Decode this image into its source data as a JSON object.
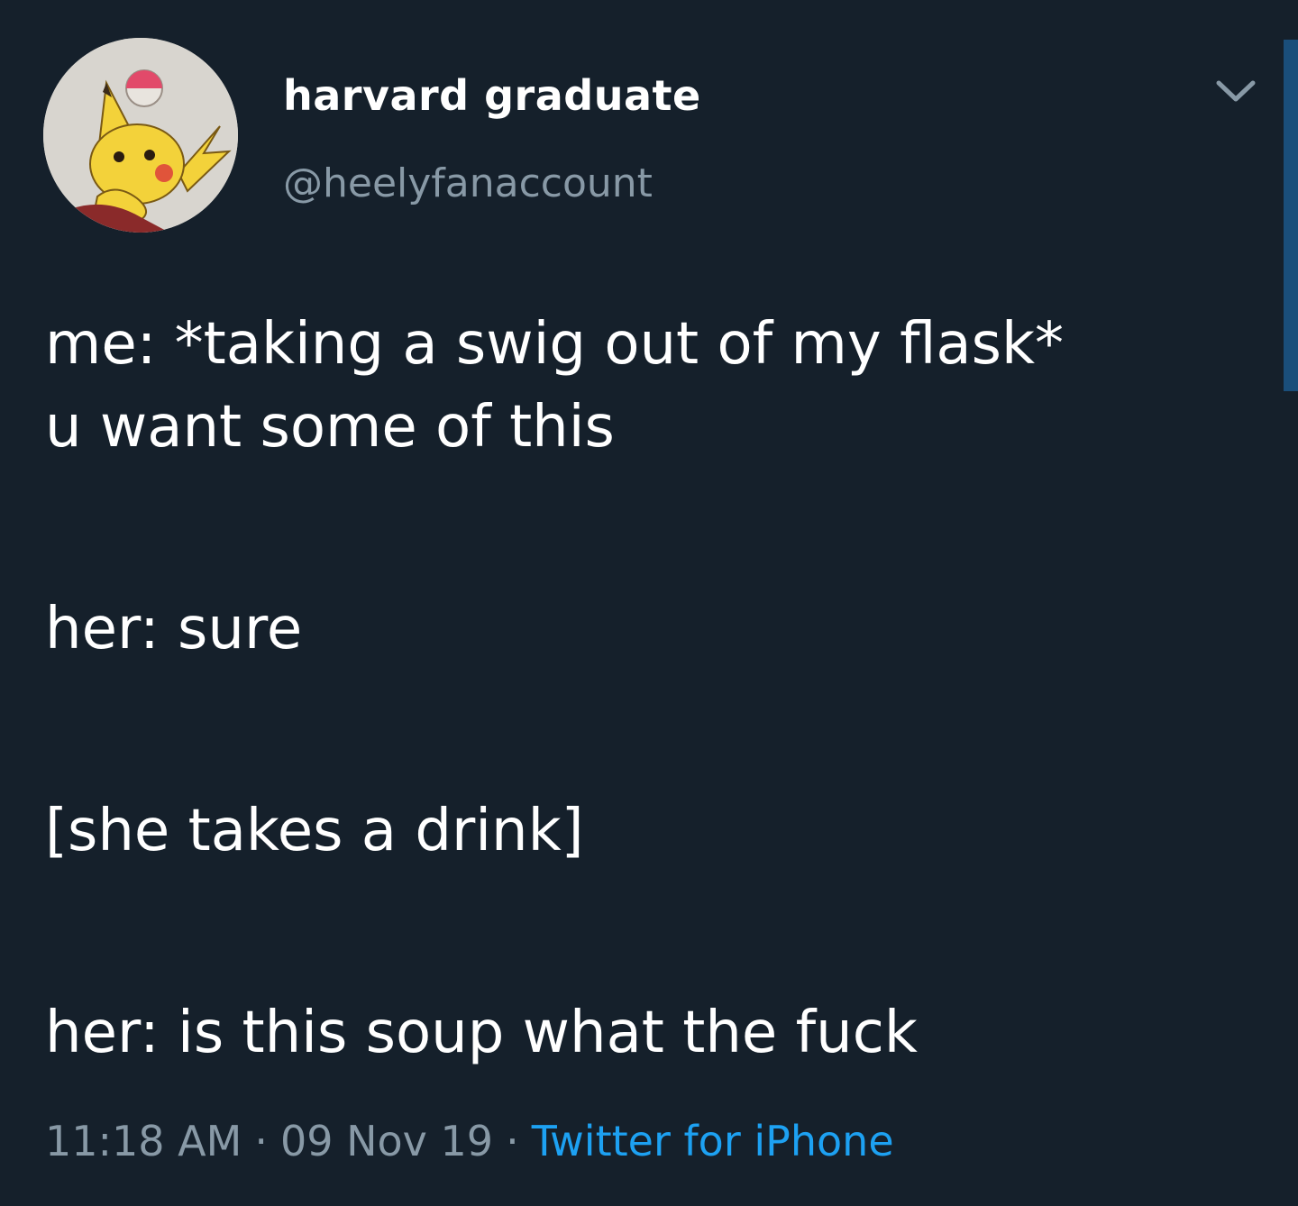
{
  "tweet": {
    "display_name": "harvard graduate",
    "handle": "@heelyfanaccount",
    "avatar_icon": "pikachu-avatar-icon",
    "menu_icon": "chevron-down-icon",
    "text_lines": {
      "line1": "me: *taking a swig out of my flask*",
      "line2": "u want some of this",
      "line3": "her: sure",
      "line4": "[she takes a drink]",
      "line5": "her: is this soup what the fuck"
    },
    "time": "11:18 AM",
    "date": "09 Nov 19",
    "separator": "·",
    "source": "Twitter for iPhone"
  },
  "colors": {
    "background": "#15202b",
    "text_primary": "#ffffff",
    "text_secondary": "#8899a6",
    "link": "#1da1f2",
    "scrollbar": "#1a4e7a"
  }
}
